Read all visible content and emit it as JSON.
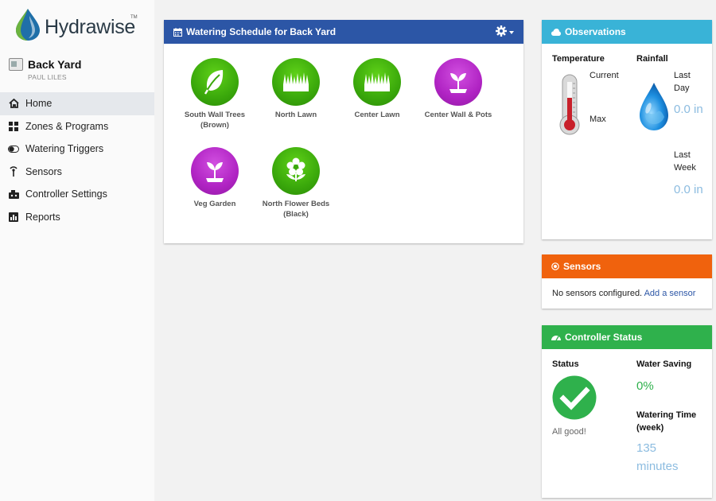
{
  "app": {
    "logo_text": "Hydrawise",
    "logo_tm": "TM"
  },
  "controller": {
    "name": "Back Yard",
    "user": "PAUL LILES"
  },
  "nav": [
    {
      "label": "Home",
      "icon": "home-icon",
      "active": true
    },
    {
      "label": "Zones & Programs",
      "icon": "grid-icon"
    },
    {
      "label": "Watering Triggers",
      "icon": "toggle-icon"
    },
    {
      "label": "Sensors",
      "icon": "antenna-icon"
    },
    {
      "label": "Controller Settings",
      "icon": "controller-icon"
    },
    {
      "label": "Reports",
      "icon": "bar-chart-icon"
    }
  ],
  "schedule": {
    "title": "Watering Schedule for Back Yard",
    "zones": [
      {
        "name": "South Wall Trees",
        "sub": "(Brown)",
        "color": "green",
        "icon": "leaf-icon"
      },
      {
        "name": "North Lawn",
        "sub": "",
        "color": "green",
        "icon": "grass-icon"
      },
      {
        "name": "Center Lawn",
        "sub": "",
        "color": "green",
        "icon": "grass-icon"
      },
      {
        "name": "Center Wall & Pots",
        "sub": "",
        "color": "purple",
        "icon": "sprout-icon"
      },
      {
        "name": "Veg Garden",
        "sub": "",
        "color": "purple",
        "icon": "sprout-icon"
      },
      {
        "name": "North Flower Beds",
        "sub": "(Black)",
        "color": "green",
        "icon": "flower-icon"
      }
    ]
  },
  "observations": {
    "title": "Observations",
    "temperature_label": "Temperature",
    "current_label": "Current",
    "max_label": "Max",
    "rainfall_label": "Rainfall",
    "last_day_label": "Last Day",
    "last_day_value": "0.0 in",
    "last_week_label": "Last Week",
    "last_week_value": "0.0 in"
  },
  "sensors": {
    "title": "Sensors",
    "message": "No sensors configured.",
    "link": "Add a sensor"
  },
  "status": {
    "title": "Controller Status",
    "status_label": "Status",
    "status_text": "All good!",
    "water_saving_label": "Water Saving",
    "water_saving_value": "0%",
    "watering_time_label": "Watering Time (week)",
    "watering_time_value": "135 minutes"
  },
  "colors": {
    "primary": "#2c56a6",
    "observations": "#39b3d7",
    "sensors": "#f0620d",
    "status": "#2fb14c",
    "zone_green": "#3aa80b",
    "zone_purple": "#b023c3"
  }
}
